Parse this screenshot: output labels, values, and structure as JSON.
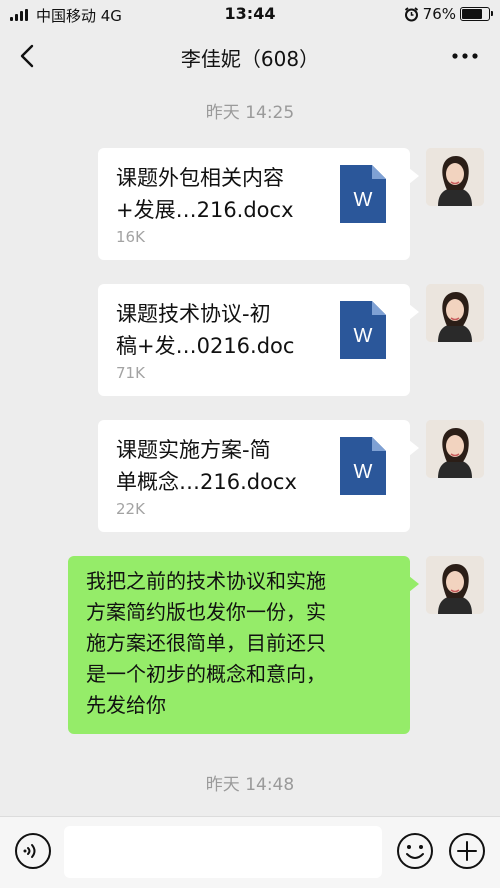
{
  "status_bar": {
    "carrier": "中国移动  4G",
    "time": "13:44",
    "battery": "76%",
    "battery_level": 0.76
  },
  "nav": {
    "title": "李佳妮（608）"
  },
  "timestamps": [
    "昨天 14:25",
    "昨天 14:48"
  ],
  "messages": [
    {
      "type": "file",
      "name_line1": "课题外包相关内容",
      "name_line2": "+发展…216.docx",
      "size": "16K",
      "icon_label": "W"
    },
    {
      "type": "file",
      "name_line1": "课题技术协议-初",
      "name_line2": "稿+发…0216.doc",
      "size": "71K",
      "icon_label": "W"
    },
    {
      "type": "file",
      "name_line1": "课题实施方案-简",
      "name_line2": "单概念…216.docx",
      "size": "22K",
      "icon_label": "W"
    },
    {
      "type": "text",
      "lines": [
        "我把之前的技术协议和实施",
        "方案简约版也发你一份，实",
        "施方案还很简单，目前还只",
        "是一个初步的概念和意向，",
        "先发给你"
      ]
    }
  ],
  "colors": {
    "background": "#ededed",
    "sent_bubble": "#95ec69",
    "file_bubble": "#ffffff",
    "word_icon": "#2b579a"
  },
  "icons": {
    "back": "chevron-left-icon",
    "more": "more-dots-icon",
    "voice": "voice-icon",
    "emoji": "emoji-icon",
    "plus": "plus-icon",
    "file": "word-document-icon"
  }
}
